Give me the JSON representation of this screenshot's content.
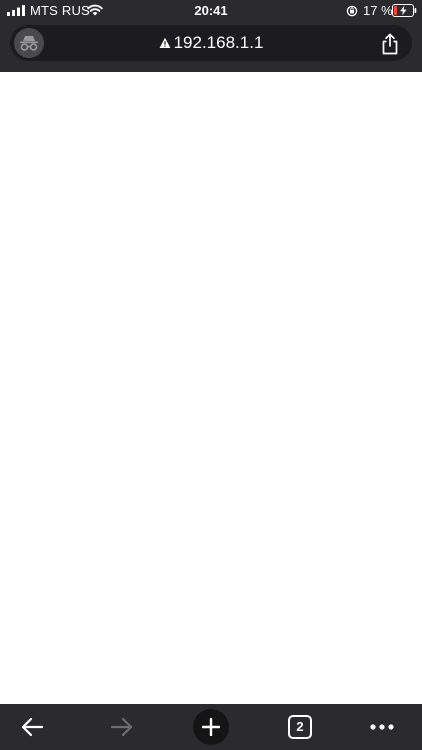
{
  "status_bar": {
    "carrier": "MTS RUS",
    "time": "20:41",
    "battery_percent": "17 %",
    "battery_level": 0.17,
    "charging": true
  },
  "address_bar": {
    "url": "192.168.1.1",
    "security_state": "not-secure-warning-icon",
    "mode": "incognito-icon"
  },
  "toolbar": {
    "back_icon": "arrow-left-icon",
    "forward_icon": "arrow-right-icon",
    "new_tab_icon": "plus-icon",
    "tab_count": "2",
    "menu_icon": "more-dots-icon"
  },
  "colors": {
    "chrome_background": "#2b2b2d",
    "address_field": "#1c1c1e",
    "battery_low": "#ff453a",
    "page_background": "#ffffff"
  }
}
